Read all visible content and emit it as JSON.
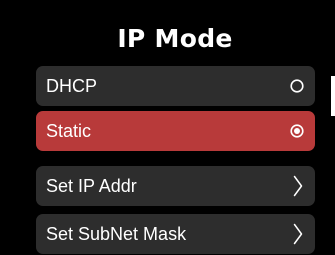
{
  "screen": {
    "title": "IP Mode"
  },
  "menu": {
    "items": [
      {
        "label": "DHCP",
        "control": "radio",
        "selected": false,
        "icon": "radio-empty-icon"
      },
      {
        "label": "Static",
        "control": "radio",
        "selected": true,
        "icon": "radio-checked-icon"
      },
      {
        "label": "Set IP Addr",
        "control": "submenu",
        "icon": "chevron-right-icon"
      },
      {
        "label": "Set SubNet Mask",
        "control": "submenu",
        "icon": "chevron-right-icon"
      }
    ]
  },
  "colors": {
    "background": "#000000",
    "item_background": "#2d2d2d",
    "selected_background": "#b83a3a",
    "text": "#ffffff"
  }
}
